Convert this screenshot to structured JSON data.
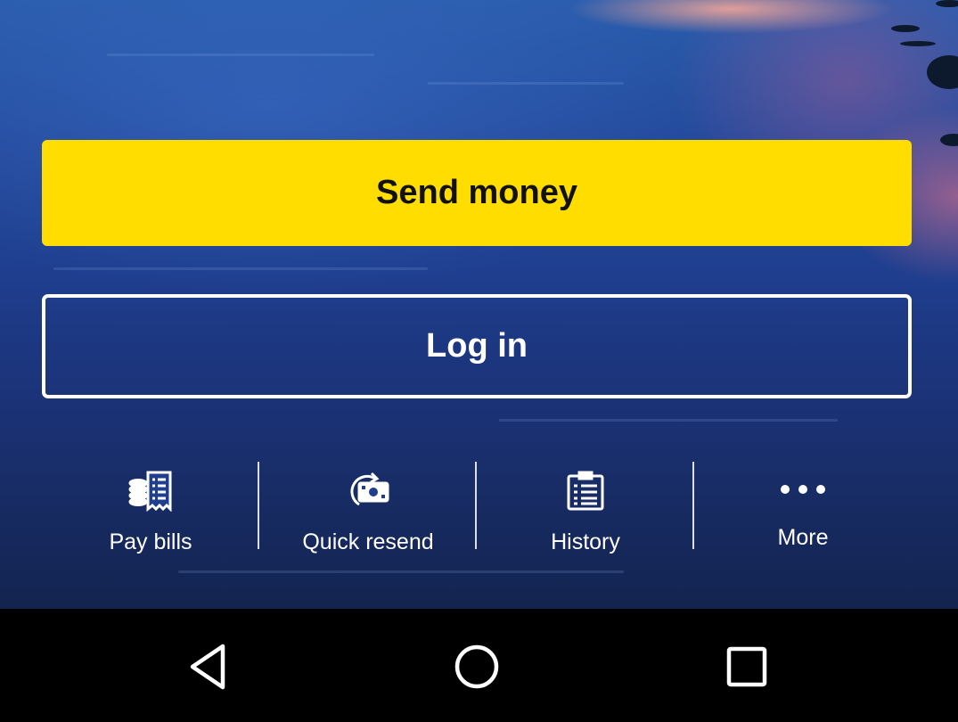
{
  "primary_action": {
    "label": "Send money",
    "color": "#ffdd00"
  },
  "secondary_action": {
    "label": "Log in"
  },
  "quick_actions": [
    {
      "label": "Pay bills",
      "icon": "pay-bills-icon"
    },
    {
      "label": "Quick resend",
      "icon": "quick-resend-icon"
    },
    {
      "label": "History",
      "icon": "history-icon"
    },
    {
      "label": "More",
      "icon": "more-dots-icon"
    }
  ],
  "system_nav": {
    "back_icon": "back-triangle-icon",
    "home_icon": "home-circle-icon",
    "recents_icon": "recents-square-icon"
  }
}
